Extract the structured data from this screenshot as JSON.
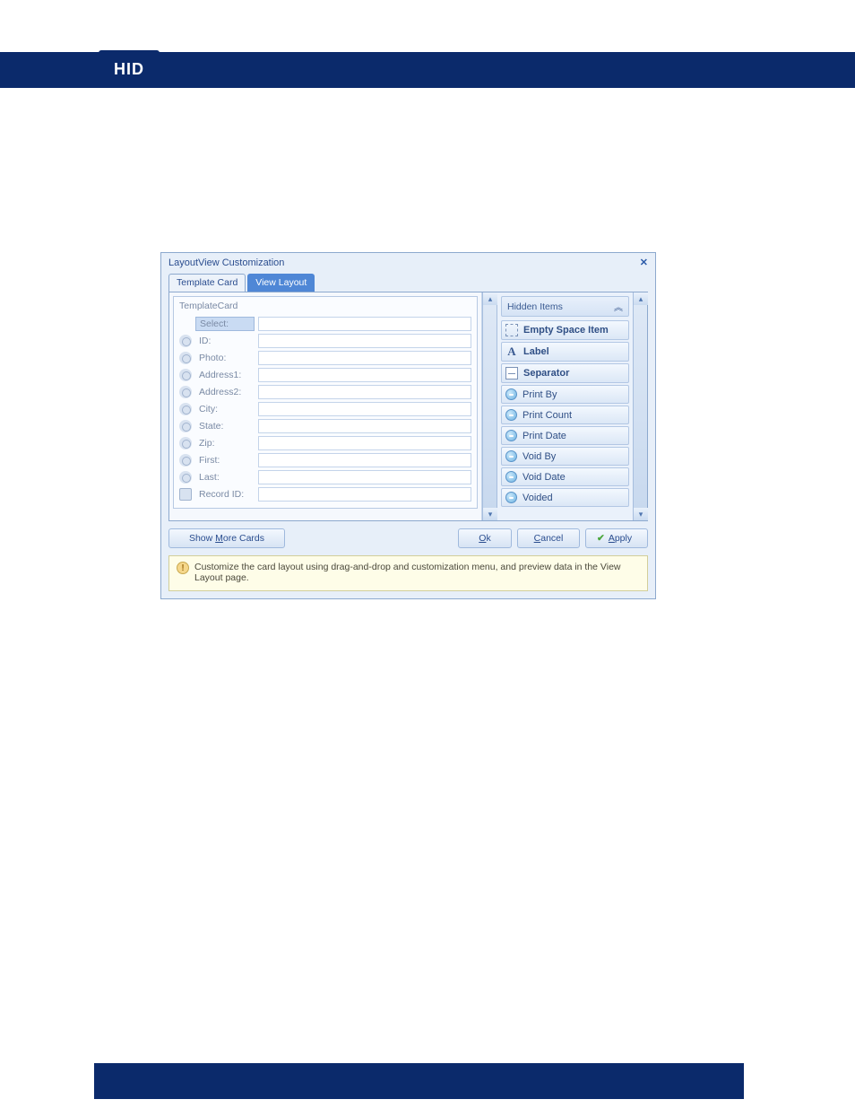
{
  "logo": "HID",
  "dialog": {
    "title": "LayoutView Customization",
    "tabs": [
      "Template Card",
      "View Layout"
    ],
    "active_tab": 1,
    "group_title": "TemplateCard",
    "fields": [
      {
        "label": "Select:",
        "icon": "none"
      },
      {
        "label": "ID:",
        "icon": "key"
      },
      {
        "label": "Photo:",
        "icon": "key"
      },
      {
        "label": "Address1:",
        "icon": "key"
      },
      {
        "label": "Address2:",
        "icon": "key"
      },
      {
        "label": "City:",
        "icon": "key"
      },
      {
        "label": "State:",
        "icon": "key"
      },
      {
        "label": "Zip:",
        "icon": "key"
      },
      {
        "label": "First:",
        "icon": "key"
      },
      {
        "label": "Last:",
        "icon": "key"
      },
      {
        "label": "Record ID:",
        "icon": "doc"
      }
    ],
    "hidden_header": "Hidden Items",
    "hidden_items": [
      {
        "label": "Empty Space Item",
        "icon": "empty",
        "bold": true
      },
      {
        "label": "Label",
        "icon": "label",
        "bold": true
      },
      {
        "label": "Separator",
        "icon": "sep",
        "bold": true
      },
      {
        "label": "Print By",
        "icon": "blue",
        "bold": false
      },
      {
        "label": "Print Count",
        "icon": "blue",
        "bold": false
      },
      {
        "label": "Print Date",
        "icon": "blue",
        "bold": false
      },
      {
        "label": "Void By",
        "icon": "blue",
        "bold": false
      },
      {
        "label": "Void Date",
        "icon": "blue",
        "bold": false
      },
      {
        "label": "Voided",
        "icon": "blue",
        "bold": false
      }
    ],
    "buttons": {
      "show_more": "Show More Cards",
      "ok": "Ok",
      "cancel": "Cancel",
      "apply": "Apply"
    },
    "hint": "Customize the card layout using drag-and-drop and customization menu, and preview data in the View Layout page."
  }
}
